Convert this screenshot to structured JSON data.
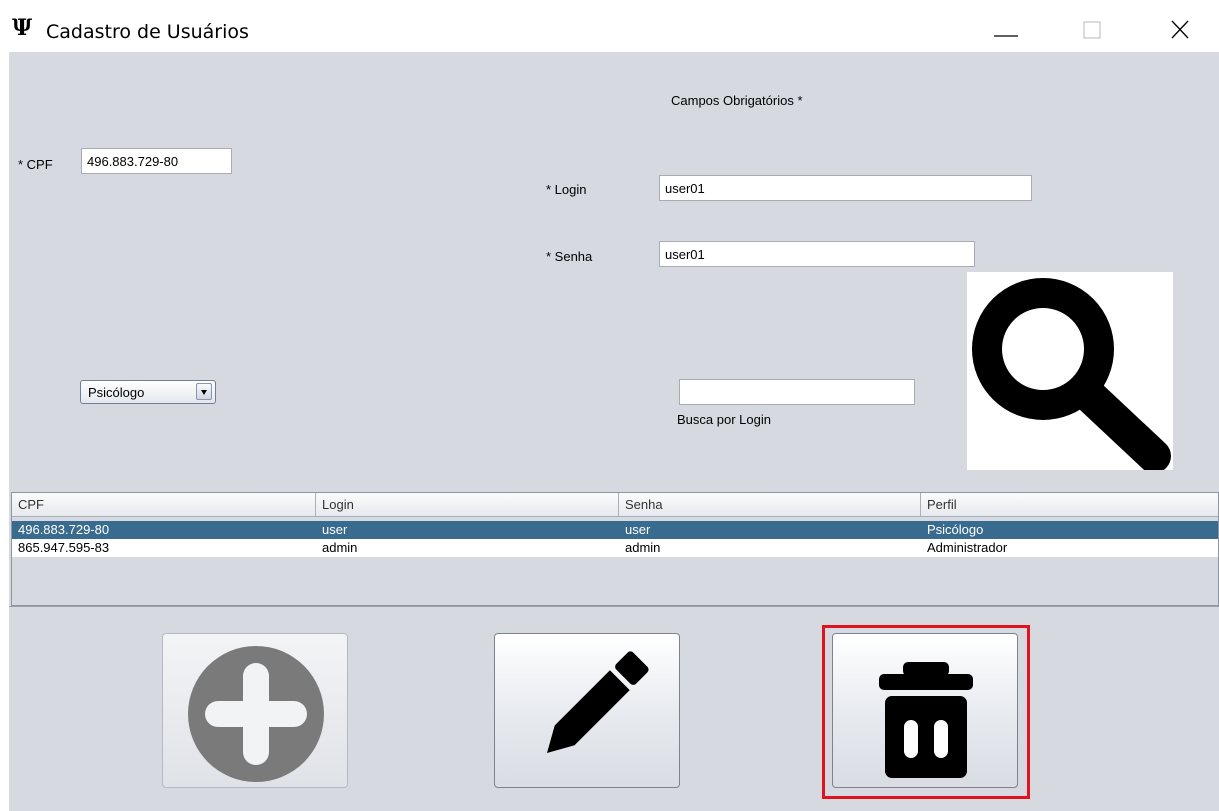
{
  "window": {
    "logo": "Ψ",
    "title": "Cadastro de Usuários"
  },
  "form": {
    "required_note": "Campos Obrigatórios *",
    "cpf_label": "* CPF",
    "cpf_value": "496.883.729-80",
    "login_label": "* Login",
    "login_value": "user01",
    "senha_label": "* Senha",
    "senha_value": "user01",
    "perfil_selected": "Psicólogo",
    "search_value": "",
    "search_label": "Busca por Login"
  },
  "table": {
    "columns": [
      "CPF",
      "Login",
      "Senha",
      "Perfil"
    ],
    "rows": [
      [
        "496.883.729-80",
        "user",
        "user",
        "Psicólogo"
      ],
      [
        "865.947.595-83",
        "admin",
        "admin",
        "Administrador"
      ]
    ],
    "selected_row": 0
  },
  "icons": {
    "search": "magnifier-icon",
    "add": "plus-circle-icon",
    "edit": "pencil-icon",
    "delete": "trash-icon"
  },
  "colors": {
    "panel_bg": "#d6d9e0",
    "selection": "#386b8d",
    "highlight": "#e0141e"
  }
}
